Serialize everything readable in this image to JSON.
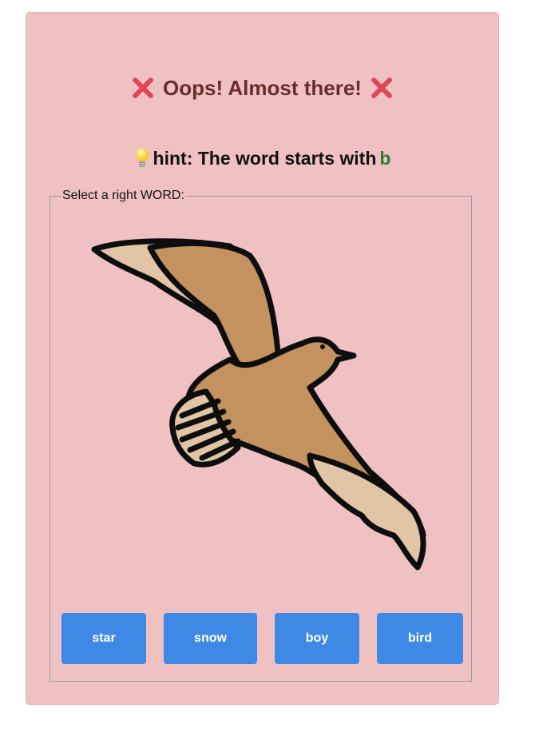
{
  "feedback": {
    "title": "Oops! Almost there!",
    "left_icon": "cross-mark-icon",
    "right_icon": "cross-mark-icon",
    "title_color": "#6b2b2b",
    "icon_color": "#e0455a"
  },
  "hint": {
    "icon": "light-bulb-icon",
    "text": "hint: The word starts with",
    "letter": "b",
    "letter_color": "#2e7d32"
  },
  "question": {
    "legend": "Select a right WORD:",
    "image": "bird-illustration"
  },
  "choices": [
    {
      "label": "star"
    },
    {
      "label": "snow"
    },
    {
      "label": "boy"
    },
    {
      "label": "bird"
    }
  ],
  "colors": {
    "card_background": "#f0c1c2",
    "button_background": "#3f89e6",
    "button_text": "#ffffff"
  }
}
